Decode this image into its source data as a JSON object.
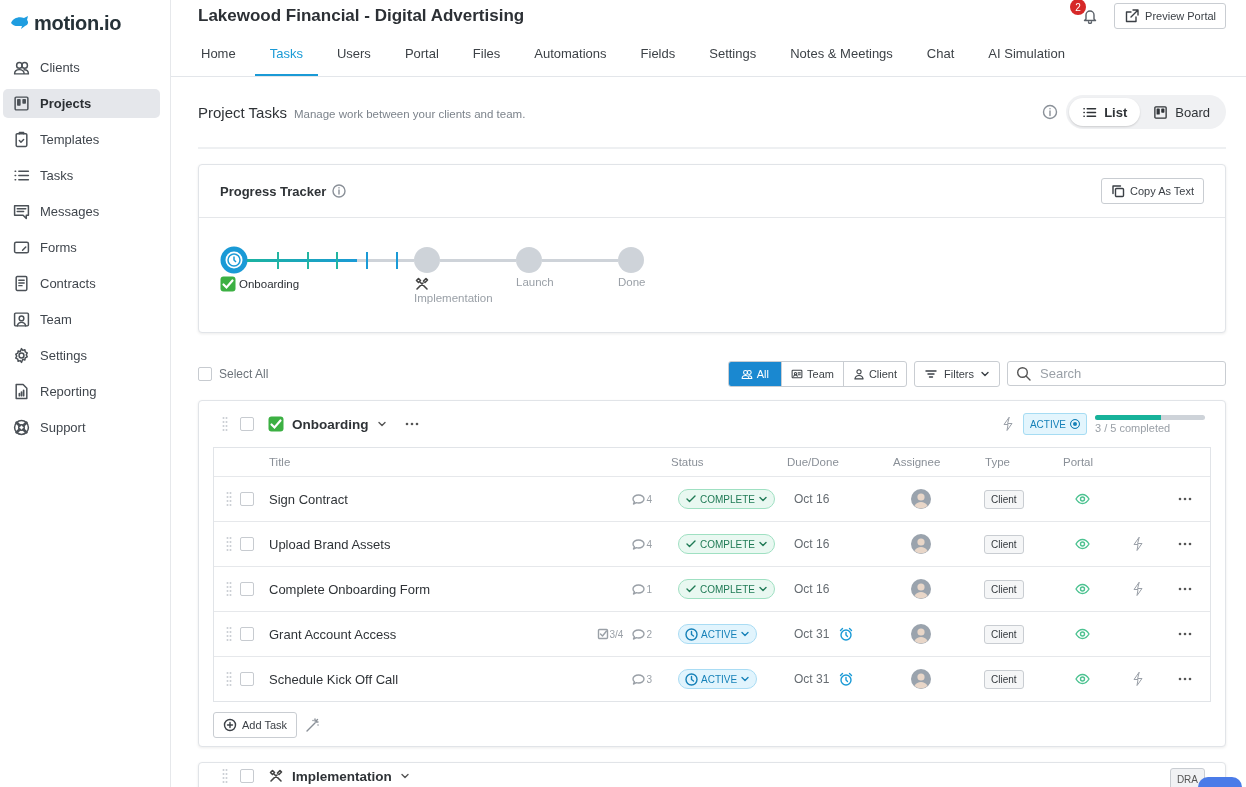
{
  "brand": {
    "name": "motion.io"
  },
  "sidebar": {
    "items": [
      {
        "label": "Clients",
        "selected": false
      },
      {
        "label": "Projects",
        "selected": true
      },
      {
        "label": "Templates",
        "selected": false
      },
      {
        "label": "Tasks",
        "selected": false
      },
      {
        "label": "Messages",
        "selected": false
      },
      {
        "label": "Forms",
        "selected": false
      },
      {
        "label": "Contracts",
        "selected": false
      },
      {
        "label": "Team",
        "selected": false
      },
      {
        "label": "Settings",
        "selected": false
      },
      {
        "label": "Reporting",
        "selected": false
      },
      {
        "label": "Support",
        "selected": false
      }
    ]
  },
  "header": {
    "title": "Lakewood Financial - Digital Advertising",
    "notifications": "2",
    "preview_button": "Preview Portal"
  },
  "tabs": [
    {
      "label": "Home",
      "selected": false
    },
    {
      "label": "Tasks",
      "selected": true
    },
    {
      "label": "Users",
      "selected": false
    },
    {
      "label": "Portal",
      "selected": false
    },
    {
      "label": "Files",
      "selected": false
    },
    {
      "label": "Automations",
      "selected": false
    },
    {
      "label": "Fields",
      "selected": false
    },
    {
      "label": "Settings",
      "selected": false
    },
    {
      "label": "Notes & Meetings",
      "selected": false
    },
    {
      "label": "Chat",
      "selected": false
    },
    {
      "label": "AI Simulation",
      "selected": false
    }
  ],
  "section": {
    "title": "Project Tasks",
    "subtitle": "Manage work between your clients and team.",
    "views": [
      {
        "label": "List",
        "selected": true
      },
      {
        "label": "Board",
        "selected": false
      }
    ]
  },
  "tracker": {
    "title": "Progress Tracker",
    "copy_button": "Copy As Text",
    "stages": [
      {
        "label": "Onboarding",
        "current": true,
        "level": 0.66
      },
      {
        "label": "Implementation",
        "current": false
      },
      {
        "label": "Launch",
        "current": false
      },
      {
        "label": "Done",
        "current": false
      }
    ]
  },
  "toolbar": {
    "select_all": {
      "label": "Select All",
      "checked": false
    },
    "segments": [
      {
        "label": "All",
        "selected": true
      },
      {
        "label": "Team",
        "selected": false
      },
      {
        "label": "Client",
        "selected": false
      }
    ],
    "filters": "Filters",
    "search": {
      "placeholder": "Search"
    }
  },
  "groups": [
    {
      "title": "Onboarding",
      "checked": false,
      "status": "ACTIVE",
      "level": 0.6,
      "progress": "3 / 5 completed",
      "columns": [
        "Title",
        "Status",
        "Due/Done",
        "Assignee",
        "Type",
        "Portal"
      ],
      "tasks": [
        {
          "title": "Sign Contract",
          "checked": false,
          "comments": "4",
          "kind": "complete",
          "status": "COMPLETE",
          "due": "Oct 16",
          "alarm": false,
          "type": "Client",
          "portal": true,
          "automation": false
        },
        {
          "title": "Upload Brand Assets",
          "checked": false,
          "comments": "4",
          "kind": "complete",
          "status": "COMPLETE",
          "due": "Oct 16",
          "alarm": false,
          "type": "Client",
          "portal": true,
          "automation": true
        },
        {
          "title": "Complete Onboarding Form",
          "checked": false,
          "comments": "1",
          "kind": "complete",
          "status": "COMPLETE",
          "due": "Oct 16",
          "alarm": false,
          "type": "Client",
          "portal": true,
          "automation": true
        },
        {
          "title": "Grant Account Access",
          "checked": false,
          "checklist": "3/4",
          "comments": "2",
          "kind": "active",
          "status": "ACTIVE",
          "due": "Oct 31",
          "alarm": true,
          "type": "Client",
          "portal": true,
          "automation": false
        },
        {
          "title": "Schedule Kick Off Call",
          "checked": false,
          "comments": "3",
          "kind": "active",
          "status": "ACTIVE",
          "due": "Oct 31",
          "alarm": true,
          "type": "Client",
          "portal": true,
          "automation": true
        }
      ],
      "add_button": "Add Task"
    },
    {
      "title": "Implementation",
      "checked": false,
      "status": "DRA"
    }
  ]
}
